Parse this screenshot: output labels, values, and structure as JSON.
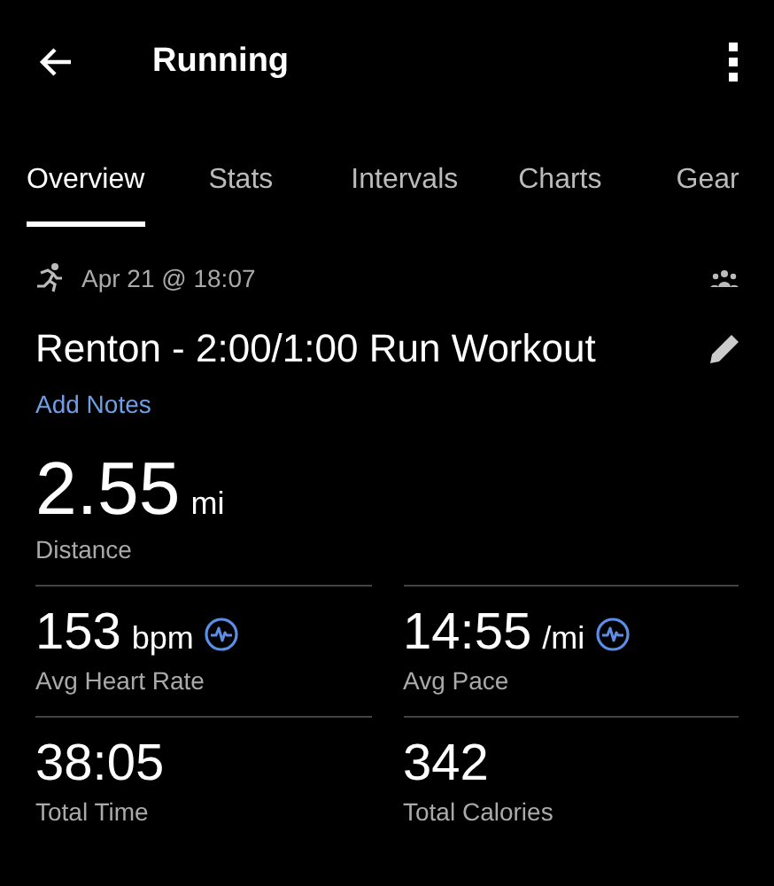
{
  "header": {
    "title": "Running"
  },
  "tabs": [
    {
      "label": "Overview",
      "selected": true
    },
    {
      "label": "Stats",
      "selected": false
    },
    {
      "label": "Intervals",
      "selected": false
    },
    {
      "label": "Charts",
      "selected": false
    },
    {
      "label": "Gear",
      "selected": false
    }
  ],
  "activity": {
    "date": "Apr 21 @ 18:07",
    "title": "Renton - 2:00/1:00 Run Workout",
    "notes_link": "Add Notes"
  },
  "distance": {
    "value": "2.55",
    "unit": "mi",
    "label": "Distance"
  },
  "stats": [
    {
      "value": "153",
      "unit": "bpm",
      "label": "Avg Heart Rate",
      "kind": "chart"
    },
    {
      "value": "14:55",
      "unit": "/mi",
      "label": "Avg Pace",
      "kind": "chart"
    },
    {
      "value": "38:05",
      "label": "Total Time",
      "kind": "plain"
    },
    {
      "value": "342",
      "label": "Total Calories",
      "kind": "plain"
    }
  ]
}
